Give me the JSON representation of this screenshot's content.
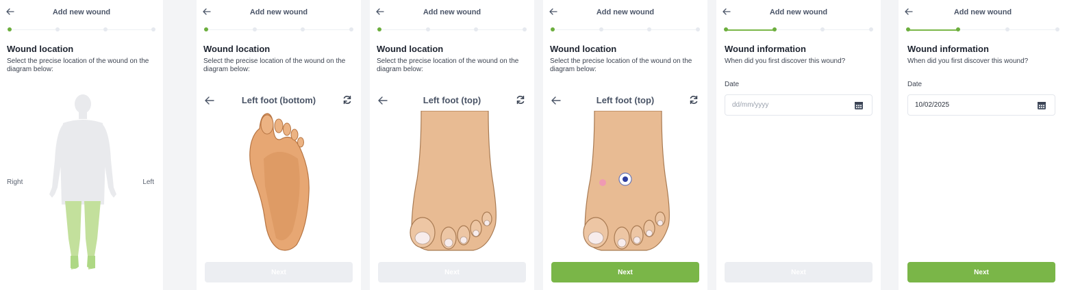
{
  "header": {
    "title": "Add new wound"
  },
  "location_section": {
    "title": "Wound location",
    "description": "Select the precise location of the wound on the diagram below:"
  },
  "info_section": {
    "title": "Wound information",
    "description": "When did you first discover this wound?"
  },
  "body_diagram": {
    "right_label": "Right",
    "left_label": "Left"
  },
  "foot_views": {
    "bottom": "Left foot (bottom)",
    "top": "Left foot (top)"
  },
  "date_field": {
    "label": "Date",
    "placeholder": "dd/mm/yyyy",
    "value": "10/02/2025"
  },
  "next_label": "Next",
  "colors": {
    "accent": "#7ab648",
    "disabled": "#eceef2",
    "highlight_leg": "#c3e09c",
    "skin": "#e8bb93",
    "wound_pink": "#ef9ab3",
    "wound_blue": "#2f3fa0"
  },
  "screens": [
    {
      "step": 1,
      "completed_steps": 1,
      "next_enabled": false
    },
    {
      "step": 1,
      "completed_steps": 1,
      "next_enabled": false
    },
    {
      "step": 1,
      "completed_steps": 1,
      "next_enabled": false
    },
    {
      "step": 1,
      "completed_steps": 1,
      "next_enabled": true
    },
    {
      "step": 2,
      "completed_steps": 2,
      "next_enabled": false
    },
    {
      "step": 2,
      "completed_steps": 2,
      "next_enabled": true
    }
  ]
}
